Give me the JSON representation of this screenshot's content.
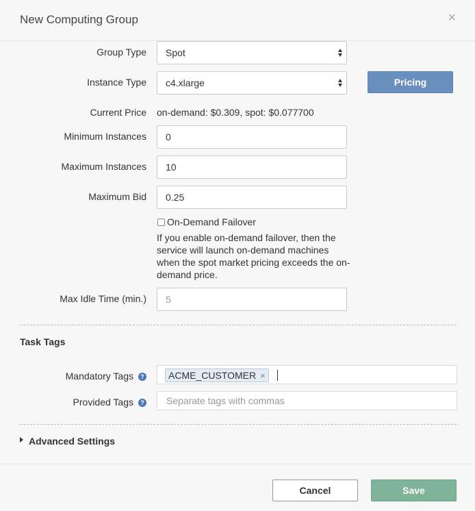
{
  "dialog": {
    "title": "New Computing Group",
    "close_glyph": "×"
  },
  "form": {
    "group_type": {
      "label": "Group Type",
      "value": "Spot"
    },
    "instance_type": {
      "label": "Instance Type",
      "value": "c4.xlarge"
    },
    "pricing_button": "Pricing",
    "current_price": {
      "label": "Current Price",
      "value": "on-demand: $0.309, spot: $0.077700"
    },
    "min_instances": {
      "label": "Minimum Instances",
      "value": "0"
    },
    "max_instances": {
      "label": "Maximum Instances",
      "value": "10"
    },
    "max_bid": {
      "label": "Maximum Bid",
      "value": "0.25"
    },
    "on_demand_failover": {
      "label": "On-Demand Failover",
      "checked": false,
      "help": "If you enable on-demand failover, then the service will launch on-demand machines when the spot market pricing exceeds the on-demand price."
    },
    "max_idle": {
      "label": "Max Idle Time (min.)",
      "placeholder": "5"
    }
  },
  "task_tags": {
    "section_title": "Task Tags",
    "mandatory": {
      "label": "Mandatory Tags",
      "tags": [
        "ACME_CUSTOMER"
      ],
      "remove_glyph": "×"
    },
    "provided": {
      "label": "Provided Tags",
      "placeholder": "Separate tags with commas"
    },
    "help_glyph": "?"
  },
  "advanced": {
    "label": "Advanced Settings"
  },
  "footer": {
    "cancel": "Cancel",
    "save": "Save"
  },
  "colors": {
    "pricing_button": "#6a8fbf",
    "save_button": "#7fb39a",
    "help_icon": "#4a78b5",
    "tag_chip": "#e4ecf5"
  }
}
